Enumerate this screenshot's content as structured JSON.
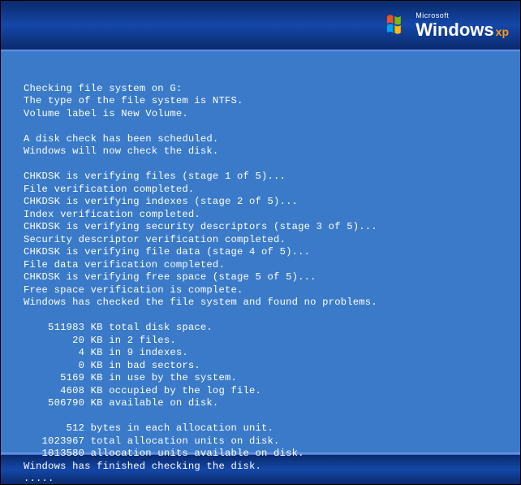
{
  "branding": {
    "company": "Microsoft",
    "product": "Windows",
    "edition": "xp"
  },
  "chkdsk": {
    "drive": "G:",
    "filesystem": "NTFS",
    "volume_label": "New Volume",
    "scheduled_msg": "A disk check has been scheduled.",
    "now_check_msg": "Windows will now check the disk.",
    "stages": [
      {
        "n": 1,
        "of": 5,
        "what": "files",
        "done": "File verification completed."
      },
      {
        "n": 2,
        "of": 5,
        "what": "indexes",
        "done": "Index verification completed."
      },
      {
        "n": 3,
        "of": 5,
        "what": "security descriptors",
        "done": "Security descriptor verification completed."
      },
      {
        "n": 4,
        "of": 5,
        "what": "file data",
        "done": "File data verification completed."
      },
      {
        "n": 5,
        "of": 5,
        "what": "free space",
        "done": "Free space verification is complete."
      }
    ],
    "result": "Windows has checked the file system and found no problems.",
    "summary": {
      "total_kb": 511983,
      "files_kb": 20,
      "files_count": 2,
      "indexes_kb": 4,
      "indexes_count": 9,
      "bad_kb": 0,
      "system_kb": 5169,
      "log_kb": 4608,
      "available_kb": 506790,
      "bytes_per_unit": 512,
      "total_units": 1023967,
      "available_units": 1013580
    },
    "finished": "Windows has finished checking the disk.",
    "trail": "....."
  }
}
